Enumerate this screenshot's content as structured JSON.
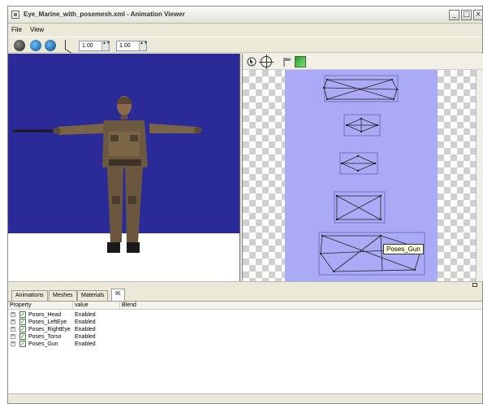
{
  "window": {
    "title": "Eye_Marine_with_posemesh.xml - Animation Viewer",
    "buttons": {
      "minimize": "_",
      "maximize": "□",
      "close": "×"
    }
  },
  "menu": {
    "file": "File",
    "view": "View"
  },
  "toolbar": {
    "spin1_value": "1.00",
    "spin2_value": "1.00",
    "spin_arrows": "▲▼",
    "icons": [
      "sphere-dark-icon",
      "sphere-blue-icon",
      "sphere-blue-2-icon",
      "axis-icon"
    ]
  },
  "viewport": {
    "background": "#2a2b98",
    "floor": "#ffffff"
  },
  "pose_editor": {
    "canvas_color": "#aaaaf6",
    "tooltip": "Poses_Gun",
    "icons": [
      "cursor-icon",
      "crosshair-icon",
      "flag-icon",
      "map-icon"
    ]
  },
  "tabs": [
    {
      "label": "Animations"
    },
    {
      "label": "Meshes"
    },
    {
      "label": "Materials"
    },
    {
      "label": "IK"
    }
  ],
  "properties": {
    "columns": [
      "Property",
      "value",
      "Blend"
    ],
    "expander": "+",
    "check": "✓",
    "rows": [
      {
        "name": "Poses_Head",
        "value": "Enabled"
      },
      {
        "name": "Poses_LeftEye",
        "value": "Enabled"
      },
      {
        "name": "Poses_RightEye",
        "value": "Enabled"
      },
      {
        "name": "Poses_Torso",
        "value": "Enabled"
      },
      {
        "name": "Poses_Gun",
        "value": "Enabled"
      }
    ]
  }
}
